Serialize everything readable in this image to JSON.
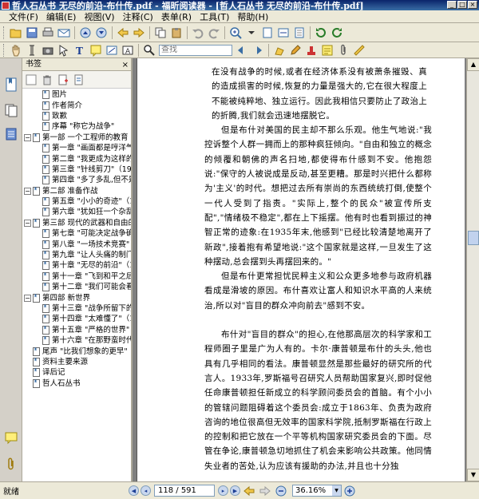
{
  "window": {
    "title": "哲人石丛书 无尽的前沿-布什传.pdf - 福昕阅读器 - [哲人石丛书 无尽的前沿-布什传.pdf]"
  },
  "menu": [
    "文件(F)",
    "编辑(E)",
    "视图(V)",
    "注释(C)",
    "表单(R)",
    "工具(T)",
    "帮助(H)"
  ],
  "toolbar": {
    "search_placeholder": "查找"
  },
  "panel": {
    "title": "书签",
    "close": "×"
  },
  "bookmarks": [
    {
      "label": "图片",
      "level": 1,
      "expandable": false
    },
    {
      "label": "作者简介",
      "level": 1,
      "expandable": false
    },
    {
      "label": "致歉",
      "level": 1,
      "expandable": false
    },
    {
      "label": "序幕 \"称它为战争\"",
      "level": 1,
      "expandable": false
    },
    {
      "label": "第一部 一个工程师的教育",
      "level": 0,
      "expandable": true
    },
    {
      "label": "第一章 \"画面都是哼洋气\"",
      "level": 1,
      "expandable": false
    },
    {
      "label": "第二章 \"我更成为这样的",
      "level": 1,
      "expandable": false
    },
    {
      "label": "第三章 \"针线剪刀\"（1919",
      "level": 1,
      "expandable": false
    },
    {
      "label": "第四章 \"多了多乱,但不是",
      "level": 1,
      "expandable": false
    },
    {
      "label": "第二部 准备作战",
      "level": 0,
      "expandable": true
    },
    {
      "label": "第五章 \"小小的奇迹\"（19",
      "level": 1,
      "expandable": false
    },
    {
      "label": "第六章 \"犹如狂一个杂乱",
      "level": 1,
      "expandable": false
    },
    {
      "label": "第三部 现代的武器和自由的",
      "level": 0,
      "expandable": true
    },
    {
      "label": "第七章 \"可能决定战争确",
      "level": 1,
      "expandable": false
    },
    {
      "label": "第八章 \"一场技术竞赛\"（",
      "level": 1,
      "expandable": false
    },
    {
      "label": "第九章 \"让人头痛的制门\"",
      "level": 1,
      "expandable": false
    },
    {
      "label": "第十章 \"无尽的前沿\"（19",
      "level": 1,
      "expandable": false
    },
    {
      "label": "第十一章 \"飞到和平之后\"",
      "level": 1,
      "expandable": false
    },
    {
      "label": "第十二章 \"我们可能会看",
      "level": 1,
      "expandable": false
    },
    {
      "label": "第四部 新世界",
      "level": 0,
      "expandable": true
    },
    {
      "label": "第十三章 \"战争所留下的",
      "level": 1,
      "expandable": false
    },
    {
      "label": "第十四章 \"太难懂了\"（19",
      "level": 1,
      "expandable": false
    },
    {
      "label": "第十五章 \"严格的世界\"（",
      "level": 1,
      "expandable": false
    },
    {
      "label": "第十六章 \"在那野蛮时代",
      "level": 1,
      "expandable": false
    },
    {
      "label": "尾声 \"比我们想象的更早\"",
      "level": 0,
      "expandable": false
    },
    {
      "label": "资料主要来源",
      "level": 0,
      "expandable": false
    },
    {
      "label": "译后记",
      "level": 0,
      "expandable": false
    },
    {
      "label": "哲人石丛书",
      "level": 0,
      "expandable": false
    }
  ],
  "page_content": {
    "quote_top": "在没有战争的时候,或者在经济体系没有被萧条摧毁、真的造成损害的时候,恢复的力量是强大的,它在很大程度上不能被纯粹地、独立运行。因此我相信只要防止了政治上的折腾,我们就会迅速地摆脱它。",
    "para1": "但是布什对美国的民主却不那么乐观。他生气地说:\"我控诉整个人群一拥而上的那种疯狂倾向。\"自由和独立的概念的倾覆和朝佛的声名扫地,都使得布什感到不安。他抱怨说:\"保守的人被说成是反动,甚至更糟。那是时兴把什么都称为'主义'的时代。想把过去所有崇尚的东西统统打倒,使整个一代人受到了指责。\"实际上,整个的民众\"被宣传所支配\",\"情绪极不稳定\",都在上下摇摆。他有时也看到振过的神智正常的迹象:在1935年末,他感到\"已经比较清楚地离开了新政\",接着抱有希望地说:\"这个国家就是这样,一旦发生了这种摆动,总会摆到头再摆回来的。\"",
    "para2": "但是布什更常担忧民粹主义和公众更多地参与政府机器看成是滑坡的原因。布什喜欢让富人和知识水平高的人来统治,所以对\"盲目的群众冲向前去\"感到不安。",
    "para3": "布什对\"盲目的群众\"的担心,在他那高层次的科学家和工程师圈子里是广为人有的。卡尔·康普顿是布什的头头,他也具有几乎相同的看法。康普顿显然是那些最好的研究所的代言人。1933年,罗斯福号召研究人员帮助国家复兴,即时促他任命康普顿担任新成立的科学顾问委员会的首脑。有个小小的管辖问题阻碍着这个委员会:成立于1863年、负责为政府咨询的地位很高但无效率的国家科学院,抵制罗斯福在行政上的控制和把它放在一个平等机构国家研究委员会的下面。尽管在争论,康普顿急切地抓住了机会来影响公共政策。他同情失业者的苦处,认为应该有援助的办法,并且也十分独"
  },
  "status": {
    "text": "就绪",
    "page_display": "118 / 591",
    "zoom": "36.16%"
  }
}
